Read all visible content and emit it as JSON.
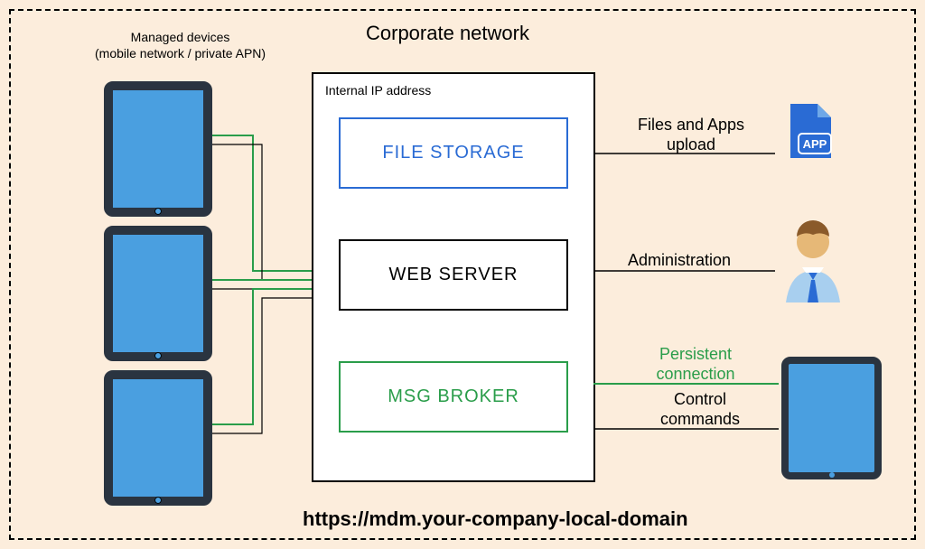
{
  "title": "Corporate network",
  "devices_label_line1": "Managed devices",
  "devices_label_line2": "(mobile network / private APN)",
  "server": {
    "label": "Internal IP address",
    "file_storage": "FILE STORAGE",
    "web_server": "WEB SERVER",
    "msg_broker": "MSG BROKER"
  },
  "edges": {
    "files_upload_line1": "Files and Apps",
    "files_upload_line2": "upload",
    "administration": "Administration",
    "persistent_line1": "Persistent",
    "persistent_line2": "connection",
    "control_line1": "Control",
    "control_line2": "commands"
  },
  "footer_url": "https://mdm.your-company-local-domain",
  "colors": {
    "bg": "#fceddc",
    "blue": "#2a6bd4",
    "green": "#2a9d4a",
    "tablet": "#4a9fe0",
    "frame": "#2a3440"
  }
}
